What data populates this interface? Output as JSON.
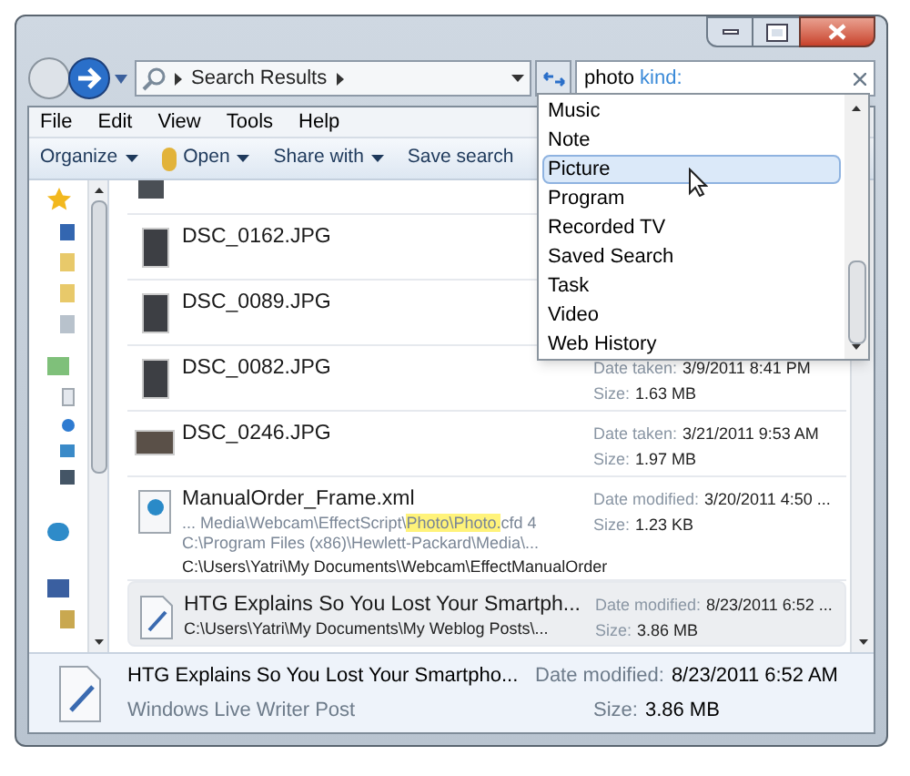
{
  "address_bar": {
    "crumb": "Search Results"
  },
  "search": {
    "value": "photo",
    "keyword": "kind:"
  },
  "menu": [
    "File",
    "Edit",
    "View",
    "Tools",
    "Help"
  ],
  "toolbar": [
    "Organize",
    "Open",
    "Share with",
    "Save search"
  ],
  "dropdown": [
    {
      "label": "Music",
      "selected": false
    },
    {
      "label": "Note",
      "selected": false
    },
    {
      "label": "Picture",
      "selected": true
    },
    {
      "label": "Program",
      "selected": false
    },
    {
      "label": "Recorded TV",
      "selected": false
    },
    {
      "label": "Saved Search",
      "selected": false
    },
    {
      "label": "Task",
      "selected": false
    },
    {
      "label": "Video",
      "selected": false
    },
    {
      "label": "Web History",
      "selected": false
    }
  ],
  "results": [
    {
      "kind": "photo",
      "name": "DSC_0162.JPG",
      "selected": false
    },
    {
      "kind": "photo",
      "name": "DSC_0089.JPG",
      "selected": false
    },
    {
      "kind": "photo",
      "name": "DSC_0082.JPG",
      "date_label": "Date taken:",
      "date": "3/9/2011 8:41 PM",
      "size_label": "Size:",
      "size": "1.63 MB",
      "selected": false
    },
    {
      "kind": "wide-photo",
      "name": "DSC_0246.JPG",
      "date_label": "Date taken:",
      "date": "3/21/2011 9:53 AM",
      "size_label": "Size:",
      "size": "1.97 MB",
      "selected": false
    },
    {
      "kind": "xml",
      "name": "ManualOrder_Frame.xml",
      "date_label": "Date modified:",
      "date": "3/20/2011 4:50 ...",
      "size_label": "Size:",
      "size": "1.23 KB",
      "selected": false,
      "snippet": [
        {
          "text": "... Media\\Webcam\\EffectScript\\",
          "highlighted": false
        },
        {
          "text": "Photo\\Photo.",
          "highlighted": true
        },
        {
          "text": "cfd 4",
          "highlighted": false
        }
      ],
      "lines": [
        "C:\\Program Files (x86)\\Hewlett-Packard\\Media\\..."
      ],
      "path": "C:\\Users\\Yatri\\My Documents\\Webcam\\EffectManualOrder"
    },
    {
      "kind": "document",
      "name": "HTG Explains So You Lost Your Smartph...",
      "date_label": "Date modified:",
      "date": "8/23/2011 6:52 ...",
      "size_label": "Size:",
      "size": "3.86 MB",
      "selected": true,
      "path": "C:\\Users\\Yatri\\My Documents\\My Weblog Posts\\..."
    }
  ],
  "details": {
    "name": "HTG Explains So You Lost Your Smartpho...",
    "type": "Windows Live Writer Post",
    "date_label": "Date modified:",
    "date": "8/23/2011 6:52 AM",
    "size_label": "Size:",
    "size": "3.86 MB"
  }
}
